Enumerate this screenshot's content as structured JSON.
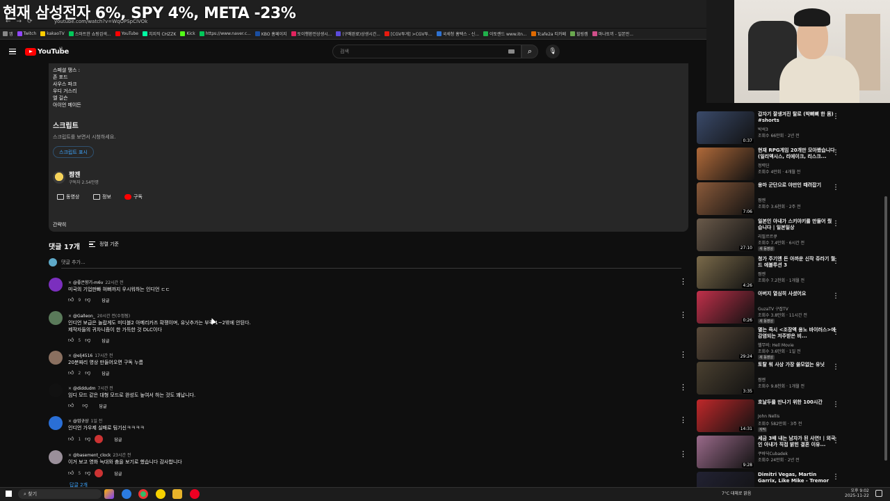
{
  "browser": {
    "headline": "현재 삼성전자 6%, SPY 4%, META -23%",
    "tab_hint": "...",
    "url": "youtube.com/watch?v=WqOPSpCIVOk",
    "bookmarks": [
      {
        "label": "앱",
        "color": "#888"
      },
      {
        "label": "Twitch",
        "color": "#9146ff"
      },
      {
        "label": "kakaoTV",
        "color": "#ffcd00"
      },
      {
        "label": "스마트한 쇼핑검색...",
        "color": "#03c75a"
      },
      {
        "label": "YouTube",
        "color": "#ff0000"
      },
      {
        "label": "치지직 CHZZK",
        "color": "#00ffa3"
      },
      {
        "label": "Kick",
        "color": "#53fc18"
      },
      {
        "label": "https://www.naver.c...",
        "color": "#03c75a"
      },
      {
        "label": "KBO 홈페이지",
        "color": "#1a4ea0"
      },
      {
        "label": "토이행환전상생시...",
        "color": "#e0245e"
      },
      {
        "label": "(구매완료)상생시간...",
        "color": "#5b4bdb"
      },
      {
        "label": "[CGV투게] >CGV투...",
        "color": "#e71a0f"
      },
      {
        "label": "국세청 홈택스 - 신...",
        "color": "#2e72d2"
      },
      {
        "label": "이토랜드 www.itn...",
        "color": "#20b04b"
      },
      {
        "label": "Tcafe2a 티카페",
        "color": "#e06a00"
      },
      {
        "label": "힐링캠",
        "color": "#6aa84f"
      },
      {
        "label": "마나토끼 - 일본만...",
        "color": "#d04f8a"
      }
    ]
  },
  "youtube": {
    "logo_text": "YouTube",
    "logo_region": "KR",
    "search_placeholder": "검색",
    "search_icon": "search-icon",
    "mic_icon": "mic-icon"
  },
  "description": {
    "cast_lines": [
      "스페셜 땡스 :",
      "존 포드",
      "사우스 파크",
      "우디 거스리",
      "엘 길슨",
      "아이언 메이든"
    ],
    "script_heading": "스크립트",
    "script_sub": "스크립트를 보면서 시청하세요.",
    "script_button": "스크립트 표시",
    "channel_name": "짬젠",
    "channel_subs": "구독자 2.54만명",
    "channel_buttons": [
      "동영상",
      "정보",
      "구독"
    ],
    "collapse_label": "간략히"
  },
  "comments": {
    "count_label": "댓글 17개",
    "sort_label": "정렬 기준",
    "add_placeholder": "댓글 추가...",
    "items": [
      {
        "author": "@좋은향기-m6v",
        "time": "22시간 전",
        "lines": [
          "미국의 기업판빠 혀뻐까지 우시워하는 인디언 ㄷㄷ"
        ],
        "likes": "9",
        "avatar_color": "#7b2fbe",
        "heart": false
      },
      {
        "author": "@Galleon_",
        "time": "20시간 전(수정됨)",
        "lines": [
          "인디언 보급은 놀랍게도 미디블2 아메리카즈 확쟁이며, 유닛추가는 부족 1~2밖에 안된다.",
          "제작자들의 귀차니즘이 한 가득한 것 DLC이다"
        ],
        "likes": "5",
        "avatar_color": "#5a7a5a",
        "heart": false
      },
      {
        "author": "@elj4516",
        "time": "17시간 전",
        "lines": [
          "20분짜리 영상 만들어오면 구독 누름"
        ],
        "likes": "2",
        "avatar_color": "#8a7060",
        "heart": false
      },
      {
        "author": "@diddudm",
        "time": "7시간 전",
        "lines": [
          "임디 모드 같은 대형 모드로 완성도 높여서 하는 것도 꽤납니다."
        ],
        "likes": "",
        "avatar_color": "#111111",
        "heart": false
      },
      {
        "author": "@엄규상",
        "time": "1일 전",
        "lines": [
          "인디언 가우제 실패로 팀기신ㅋㅋㅋㅋ"
        ],
        "likes": "1",
        "avatar_color": "#2a6fd6",
        "heart": true
      },
      {
        "author": "@basement_clock",
        "time": "23시간 전",
        "lines": [
          "이거 보고 영화 늑대와 춤을 보기로 했습니다 감사합니다"
        ],
        "likes": "5",
        "avatar_color": "#9a8f9a",
        "heart": true
      }
    ],
    "reply_label": "답글",
    "replies_toggle": "답글 2개"
  },
  "sidebar_videos": [
    {
      "title": "갑자기 잘생겨진 탈로 (박뼈뼈 한 몸) #shorts",
      "channel": "박석3",
      "meta": "조회수 66만회 · 2년 전",
      "duration": "0:37",
      "badge": "",
      "thumb": "#3a4a6a"
    },
    {
      "title": "현재 RPG게임 20개만 모아봤습니다 (일리액시스, 리에이크, 리스크...",
      "channel": "정력딘",
      "meta": "조회수 4만회 · 4개월 전",
      "duration": "",
      "badge": "",
      "thumb": "#b06a3a"
    },
    {
      "title": "용마 군단으로 야만인 때려잡기",
      "channel": "짬젠",
      "meta": "조회수 3.6천회 · 2주 전",
      "duration": "7:06",
      "badge": "",
      "thumb": "#8a5a3a"
    },
    {
      "title": "일본인 아내가 스키야키를 만들어 줬습니다 | 일본일상",
      "channel": "리필르르큐",
      "meta": "조회수 7.4만회 · 6시간 전",
      "duration": "27:10",
      "badge": "새 동영상",
      "thumb": "#6a5a4a"
    },
    {
      "title": "청가 주기엔 돈 아까운 신작 쥬라기 월드 에볼루션 3",
      "channel": "짬젠",
      "meta": "조회수 7.2천회 · 1개월 전",
      "duration": "4:26",
      "badge": "",
      "thumb": "#7a6a4a"
    },
    {
      "title": "아버지 열심히 사셨어요",
      "channel": "GuzaTV 구잡TV",
      "meta": "조회수 3.8만회 · 11시간 전",
      "duration": "0:26",
      "badge": "새 동영상",
      "thumb": "#c0304a"
    },
    {
      "title": "멸는 즉시 <조장액 용노 바이러스>에 감염되는 저주받은 비...",
      "channel": "헬무비: Hell Movie",
      "meta": "조회수 3.6만회 · 1일 전",
      "duration": "29:24",
      "badge": "새 동영상",
      "thumb": "#5a4a3a"
    },
    {
      "title": "토탈 워 사상 가장 쓸모없는 유닛",
      "channel": "짬젠",
      "meta": "조회수 9.8천회 · 1개월 전",
      "duration": "3:35",
      "badge": "",
      "thumb": "#4a4030"
    },
    {
      "title": "호날두를 만나기 위한 100시간",
      "channel": "John Nellis",
      "meta": "조회수 582만회 · 3주 전",
      "duration": "14:31",
      "badge": "자막",
      "thumb": "#c0282a"
    },
    {
      "title": "세금 3배 내는 남자가 된 사연! | 외국인 아내가 직접 밝힌 결혼 이유...",
      "channel": "쿠바딕Cubadek",
      "meta": "조회수 24만회 · 2년 전",
      "duration": "9:28",
      "badge": "",
      "thumb": "#9a6a8a"
    },
    {
      "title": "Dimitri Vegas, Martin Garrix, Like Mike - Tremor (Official ...",
      "channel": "",
      "meta": "",
      "duration": "",
      "badge": "",
      "thumb": "#222233"
    }
  ],
  "taskbar": {
    "search": "찾기",
    "tray": "7°C 대체로 맑음",
    "time": "오후 9:02",
    "date": "2025-11-22"
  },
  "colors": {
    "yt_red": "#ff0000",
    "link_blue": "#3ea6ff",
    "bg": "#0f0f0f",
    "panel": "#272727"
  }
}
